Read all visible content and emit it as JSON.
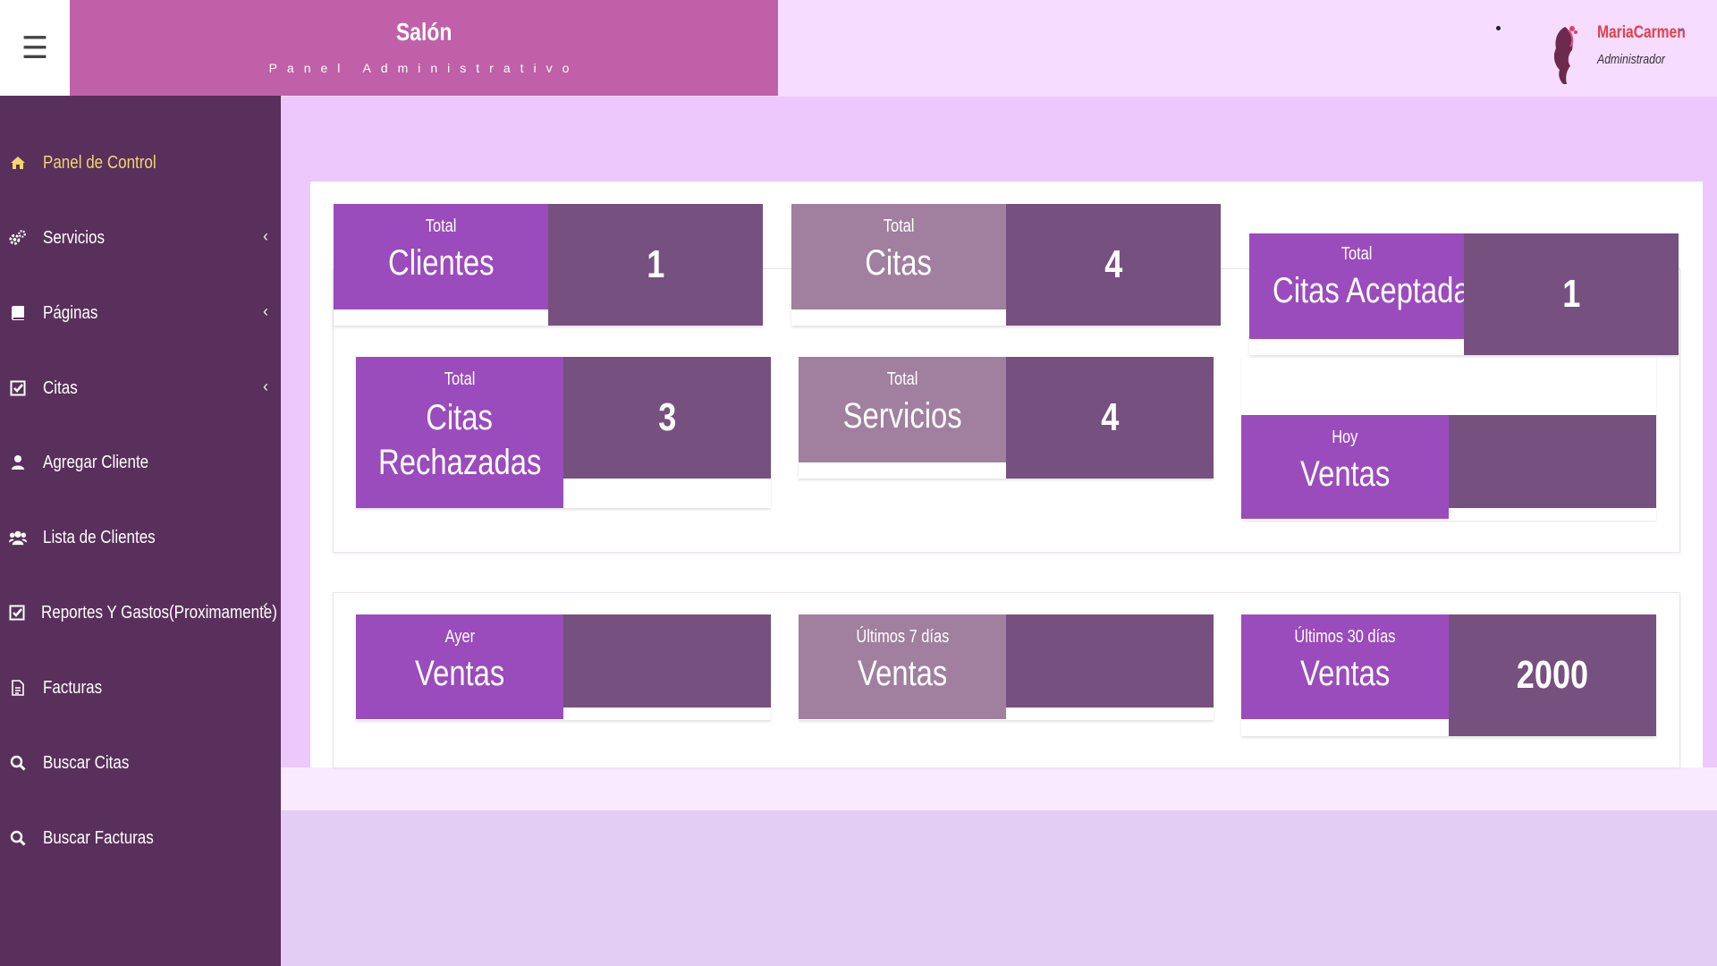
{
  "header": {
    "brand_title": "Salón",
    "brand_subtitle": "Panel Administrativo",
    "user_name": "MariaCarmen",
    "user_role": "Administrador"
  },
  "sidebar": {
    "items": [
      {
        "label": "Panel de Control",
        "icon": "home-icon"
      },
      {
        "label": "Servicios",
        "icon": "gears-icon"
      },
      {
        "label": "Páginas",
        "icon": "book-icon"
      },
      {
        "label": "Citas",
        "icon": "check-square-icon"
      },
      {
        "label": "Agregar Cliente",
        "icon": "user-icon"
      },
      {
        "label": "Lista de Clientes",
        "icon": "users-icon"
      },
      {
        "label": "Reportes Y Gastos(Proximamente)",
        "icon": "check-square-icon"
      },
      {
        "label": "Facturas",
        "icon": "file-icon"
      },
      {
        "label": "Buscar Citas",
        "icon": "search-icon"
      },
      {
        "label": "Buscar Facturas",
        "icon": "search-icon"
      }
    ]
  },
  "cards": {
    "clientes": {
      "small": "Total",
      "big": "Clientes",
      "value": "1"
    },
    "citas": {
      "small": "Total",
      "big": "Citas",
      "value": "4"
    },
    "aceptadas": {
      "small": "Total",
      "big": "Citas Aceptadas",
      "value": "1"
    },
    "rechazadas": {
      "small": "Total",
      "big1": "Citas",
      "big2": "Rechazadas",
      "value": "3"
    },
    "servicios": {
      "small": "Total",
      "big": "Servicios",
      "value": "4"
    },
    "hoy": {
      "small": "Hoy",
      "big": "Ventas",
      "value": ""
    },
    "ayer": {
      "small": "Ayer",
      "big": "Ventas",
      "value": ""
    },
    "siete": {
      "small": "Últimos 7 días",
      "big": "Ventas",
      "value": ""
    },
    "treinta": {
      "small": "Últimos 30 días",
      "big": "Ventas",
      "value": "2000"
    }
  },
  "colors": {
    "brand": "#c060a9",
    "sidebar": "#59305b",
    "active_nav": "#f2d56e",
    "label_bright": "#9a4bbc",
    "label_muted": "#a07f9f",
    "value_bg": "#76507e"
  }
}
